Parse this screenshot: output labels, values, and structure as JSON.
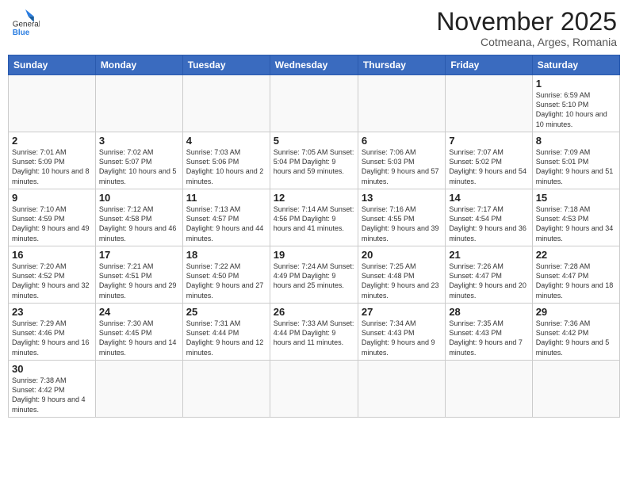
{
  "logo": {
    "general": "General",
    "blue": "Blue"
  },
  "header": {
    "month": "November 2025",
    "location": "Cotmeana, Arges, Romania"
  },
  "weekdays": [
    "Sunday",
    "Monday",
    "Tuesday",
    "Wednesday",
    "Thursday",
    "Friday",
    "Saturday"
  ],
  "weeks": [
    [
      {
        "day": "",
        "info": ""
      },
      {
        "day": "",
        "info": ""
      },
      {
        "day": "",
        "info": ""
      },
      {
        "day": "",
        "info": ""
      },
      {
        "day": "",
        "info": ""
      },
      {
        "day": "",
        "info": ""
      },
      {
        "day": "1",
        "info": "Sunrise: 6:59 AM\nSunset: 5:10 PM\nDaylight: 10 hours and 10 minutes."
      }
    ],
    [
      {
        "day": "2",
        "info": "Sunrise: 7:01 AM\nSunset: 5:09 PM\nDaylight: 10 hours and 8 minutes."
      },
      {
        "day": "3",
        "info": "Sunrise: 7:02 AM\nSunset: 5:07 PM\nDaylight: 10 hours and 5 minutes."
      },
      {
        "day": "4",
        "info": "Sunrise: 7:03 AM\nSunset: 5:06 PM\nDaylight: 10 hours and 2 minutes."
      },
      {
        "day": "5",
        "info": "Sunrise: 7:05 AM\nSunset: 5:04 PM\nDaylight: 9 hours and 59 minutes."
      },
      {
        "day": "6",
        "info": "Sunrise: 7:06 AM\nSunset: 5:03 PM\nDaylight: 9 hours and 57 minutes."
      },
      {
        "day": "7",
        "info": "Sunrise: 7:07 AM\nSunset: 5:02 PM\nDaylight: 9 hours and 54 minutes."
      },
      {
        "day": "8",
        "info": "Sunrise: 7:09 AM\nSunset: 5:01 PM\nDaylight: 9 hours and 51 minutes."
      }
    ],
    [
      {
        "day": "9",
        "info": "Sunrise: 7:10 AM\nSunset: 4:59 PM\nDaylight: 9 hours and 49 minutes."
      },
      {
        "day": "10",
        "info": "Sunrise: 7:12 AM\nSunset: 4:58 PM\nDaylight: 9 hours and 46 minutes."
      },
      {
        "day": "11",
        "info": "Sunrise: 7:13 AM\nSunset: 4:57 PM\nDaylight: 9 hours and 44 minutes."
      },
      {
        "day": "12",
        "info": "Sunrise: 7:14 AM\nSunset: 4:56 PM\nDaylight: 9 hours and 41 minutes."
      },
      {
        "day": "13",
        "info": "Sunrise: 7:16 AM\nSunset: 4:55 PM\nDaylight: 9 hours and 39 minutes."
      },
      {
        "day": "14",
        "info": "Sunrise: 7:17 AM\nSunset: 4:54 PM\nDaylight: 9 hours and 36 minutes."
      },
      {
        "day": "15",
        "info": "Sunrise: 7:18 AM\nSunset: 4:53 PM\nDaylight: 9 hours and 34 minutes."
      }
    ],
    [
      {
        "day": "16",
        "info": "Sunrise: 7:20 AM\nSunset: 4:52 PM\nDaylight: 9 hours and 32 minutes."
      },
      {
        "day": "17",
        "info": "Sunrise: 7:21 AM\nSunset: 4:51 PM\nDaylight: 9 hours and 29 minutes."
      },
      {
        "day": "18",
        "info": "Sunrise: 7:22 AM\nSunset: 4:50 PM\nDaylight: 9 hours and 27 minutes."
      },
      {
        "day": "19",
        "info": "Sunrise: 7:24 AM\nSunset: 4:49 PM\nDaylight: 9 hours and 25 minutes."
      },
      {
        "day": "20",
        "info": "Sunrise: 7:25 AM\nSunset: 4:48 PM\nDaylight: 9 hours and 23 minutes."
      },
      {
        "day": "21",
        "info": "Sunrise: 7:26 AM\nSunset: 4:47 PM\nDaylight: 9 hours and 20 minutes."
      },
      {
        "day": "22",
        "info": "Sunrise: 7:28 AM\nSunset: 4:47 PM\nDaylight: 9 hours and 18 minutes."
      }
    ],
    [
      {
        "day": "23",
        "info": "Sunrise: 7:29 AM\nSunset: 4:46 PM\nDaylight: 9 hours and 16 minutes."
      },
      {
        "day": "24",
        "info": "Sunrise: 7:30 AM\nSunset: 4:45 PM\nDaylight: 9 hours and 14 minutes."
      },
      {
        "day": "25",
        "info": "Sunrise: 7:31 AM\nSunset: 4:44 PM\nDaylight: 9 hours and 12 minutes."
      },
      {
        "day": "26",
        "info": "Sunrise: 7:33 AM\nSunset: 4:44 PM\nDaylight: 9 hours and 11 minutes."
      },
      {
        "day": "27",
        "info": "Sunrise: 7:34 AM\nSunset: 4:43 PM\nDaylight: 9 hours and 9 minutes."
      },
      {
        "day": "28",
        "info": "Sunrise: 7:35 AM\nSunset: 4:43 PM\nDaylight: 9 hours and 7 minutes."
      },
      {
        "day": "29",
        "info": "Sunrise: 7:36 AM\nSunset: 4:42 PM\nDaylight: 9 hours and 5 minutes."
      }
    ],
    [
      {
        "day": "30",
        "info": "Sunrise: 7:38 AM\nSunset: 4:42 PM\nDaylight: 9 hours and 4 minutes."
      },
      {
        "day": "",
        "info": ""
      },
      {
        "day": "",
        "info": ""
      },
      {
        "day": "",
        "info": ""
      },
      {
        "day": "",
        "info": ""
      },
      {
        "day": "",
        "info": ""
      },
      {
        "day": "",
        "info": ""
      }
    ]
  ]
}
